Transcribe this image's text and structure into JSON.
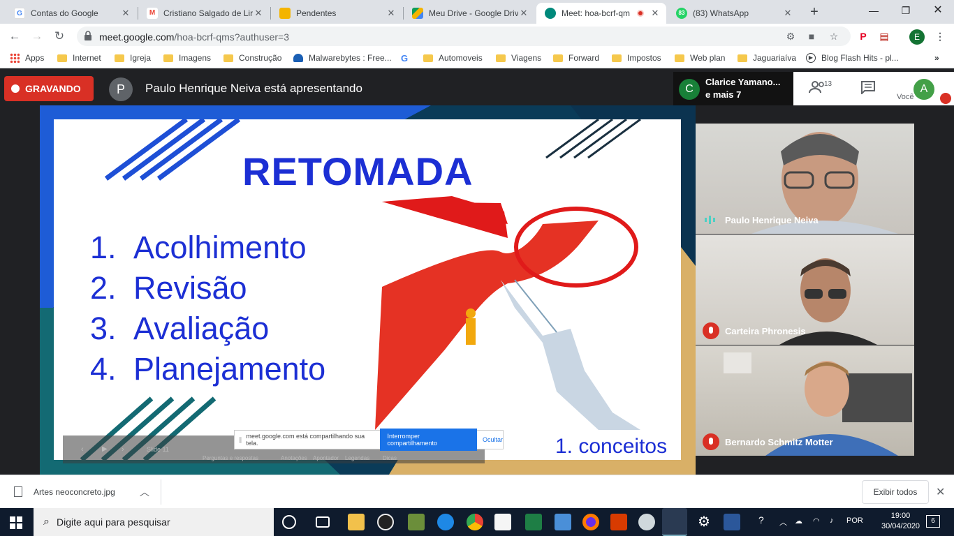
{
  "browser": {
    "tabs": [
      {
        "title": "Contas do Google",
        "icon_color": "#4285f4",
        "icon": "G",
        "active": false
      },
      {
        "title": "Cristiano Salgado de Lir",
        "icon_color": "#ea4335",
        "icon": "M",
        "active": false
      },
      {
        "title": "Pendentes",
        "icon_color": "#f4b400",
        "icon": "",
        "active": false
      },
      {
        "title": "Meu Drive - Google Driv",
        "icon_color": "#0f9d58",
        "icon": "",
        "active": false
      },
      {
        "title": "Meet: hoa-bcrf-qm",
        "icon_color": "#00897b",
        "icon": "",
        "active": true
      },
      {
        "title": "(83) WhatsApp",
        "icon_color": "#25d366",
        "icon": "83",
        "active": false
      }
    ],
    "url_host": "meet.google.com",
    "url_rest": "/hoa-bcrf-qms?authuser=3",
    "profile_letter": "E",
    "bookmarks": [
      "Apps",
      "Internet",
      "Igreja",
      "Imagens",
      "Construção",
      "Malwarebytes : Free...",
      "",
      "Automoveis",
      "Viagens",
      "Forward",
      "Impostos",
      "Web plan",
      "Jaguariaíva",
      "Blog Flash Hits - pl..."
    ]
  },
  "meet": {
    "recording_label": "GRAVANDO",
    "presenter_initial": "P",
    "presenter_text": "Paulo Henrique Neiva está apresentando",
    "people_chip_initial": "C",
    "people_chip_line1": "Clarice Yamano...",
    "people_chip_line2": "e mais 7",
    "participant_count": "13",
    "you_label": "Você",
    "you_initial": "A",
    "tiles": [
      {
        "name": "Paulo Henrique Neiva",
        "muted": false
      },
      {
        "name": "Carteira Phronesis",
        "muted": true
      },
      {
        "name": "Bernardo Schmitz Motter",
        "muted": true
      }
    ]
  },
  "slide": {
    "title": "RETOMADA",
    "items": [
      {
        "num": "1.",
        "text": "Acolhimento"
      },
      {
        "num": "2.",
        "text": "Revisão"
      },
      {
        "num": "3.",
        "text": "Avaliação"
      },
      {
        "num": "4.",
        "text": "Planejamento"
      }
    ],
    "footer": "1. conceitos",
    "ppt_slide": "Slide 11",
    "ppt_labels": [
      "Perguntas e respostas",
      "Anotações",
      "Apontador",
      "Legendas",
      "Dicas"
    ],
    "share_notice": "meet.google.com está compartilhando sua tela.",
    "stop_label": "Interromper compartilhamento",
    "hide_label": "Ocultar"
  },
  "downloads": {
    "file": "Artes neoconcreto.jpg",
    "show_all": "Exibir todos"
  },
  "taskbar": {
    "search_placeholder": "Digite aqui para pesquisar",
    "lang": "POR",
    "time": "19:00",
    "date": "30/04/2020",
    "notif_count": "6"
  }
}
